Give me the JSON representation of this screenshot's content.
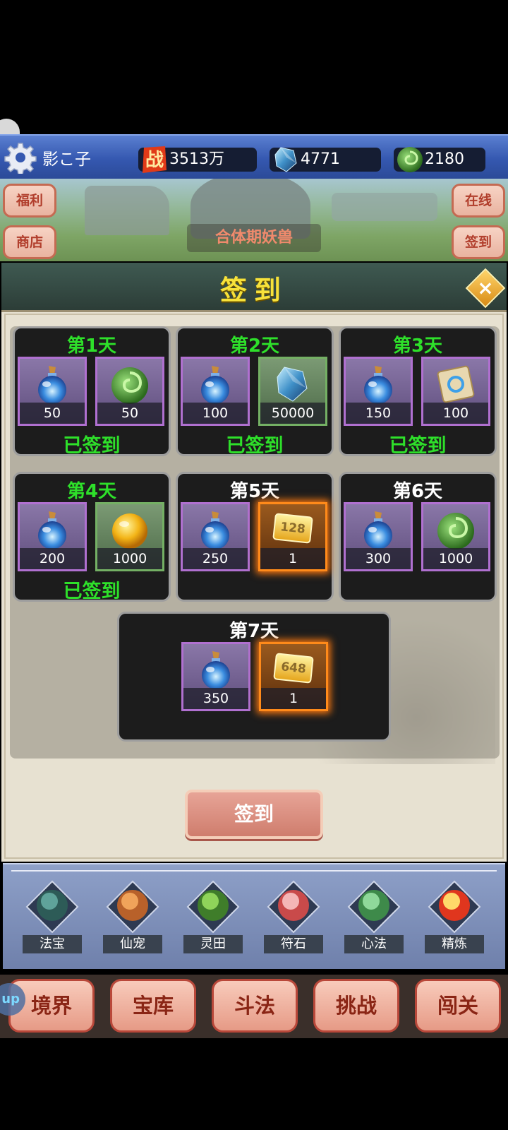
{
  "player": {
    "name": "影こ子"
  },
  "resources": [
    {
      "icon": "battle-power-icon",
      "value": "3513万"
    },
    {
      "icon": "crystal-icon",
      "value": "4771"
    },
    {
      "icon": "jade-coin-icon",
      "value": "2180"
    }
  ],
  "scene": {
    "left_buttons": [
      "福利",
      "商店"
    ],
    "right_buttons": [
      "在线",
      "签到"
    ],
    "boss_label": "合体期妖兽"
  },
  "panel": {
    "title": "签到",
    "close": "×",
    "days": [
      {
        "title": "第1天",
        "status": "已签到",
        "rewards": [
          {
            "icon": "blue-potion-icon",
            "qty": "50"
          },
          {
            "icon": "jade-coin-icon",
            "qty": "50"
          }
        ]
      },
      {
        "title": "第2天",
        "status": "已签到",
        "rewards": [
          {
            "icon": "blue-potion-icon",
            "qty": "100"
          },
          {
            "icon": "crystal-icon",
            "qty": "50000"
          }
        ]
      },
      {
        "title": "第3天",
        "status": "已签到",
        "rewards": [
          {
            "icon": "blue-potion-icon",
            "qty": "150"
          },
          {
            "icon": "scroll-icon",
            "qty": "100"
          }
        ]
      },
      {
        "title": "第4天",
        "status": "已签到",
        "rewards": [
          {
            "icon": "blue-potion-icon",
            "qty": "200"
          },
          {
            "icon": "gold-orb-icon",
            "qty": "1000"
          }
        ]
      },
      {
        "title": "第5天",
        "status": "",
        "rewards": [
          {
            "icon": "blue-potion-icon",
            "qty": "250"
          },
          {
            "icon": "gold-ticket-icon",
            "qty": "1",
            "ticket_text": "128"
          }
        ]
      },
      {
        "title": "第6天",
        "status": "",
        "rewards": [
          {
            "icon": "blue-potion-icon",
            "qty": "300"
          },
          {
            "icon": "jade-coin-icon",
            "qty": "1000"
          }
        ]
      },
      {
        "title": "第7天",
        "status": "",
        "rewards": [
          {
            "icon": "blue-potion-icon",
            "qty": "350"
          },
          {
            "icon": "gold-ticket-icon",
            "qty": "1",
            "ticket_text": "648"
          }
        ]
      }
    ],
    "sign_button": "签到"
  },
  "dock": [
    {
      "label": "法宝",
      "icon": "artifact-icon"
    },
    {
      "label": "仙宠",
      "icon": "fox-pet-icon"
    },
    {
      "label": "灵田",
      "icon": "spirit-field-icon"
    },
    {
      "label": "符石",
      "icon": "rune-stone-icon"
    },
    {
      "label": "心法",
      "icon": "manual-book-icon"
    },
    {
      "label": "精炼",
      "icon": "refine-scroll-icon"
    }
  ],
  "nav": [
    "境界",
    "宝库",
    "斗法",
    "挑战",
    "闯关"
  ],
  "colors": {
    "signed_green": "#2ee02a",
    "title_yellow": "#f7e23a",
    "topbar_blue": "#3558b0"
  }
}
